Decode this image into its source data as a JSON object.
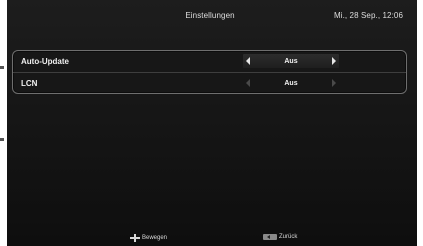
{
  "header": {
    "title": "Einstellungen",
    "datetime": "Mi., 28 Sep., 12:06"
  },
  "settings": [
    {
      "label": "Auto-Update",
      "value": "Aus",
      "selected": true
    },
    {
      "label": "LCN",
      "value": "Aus",
      "selected": false
    }
  ],
  "footer": {
    "move_icon": "dpad-icon",
    "move_label": "Bewegen",
    "back_icon": "back-icon",
    "back_label": "Zurück"
  },
  "colors": {
    "background": "#141414",
    "text": "#e6e6e6",
    "panel_border": "#6e6e6e"
  }
}
